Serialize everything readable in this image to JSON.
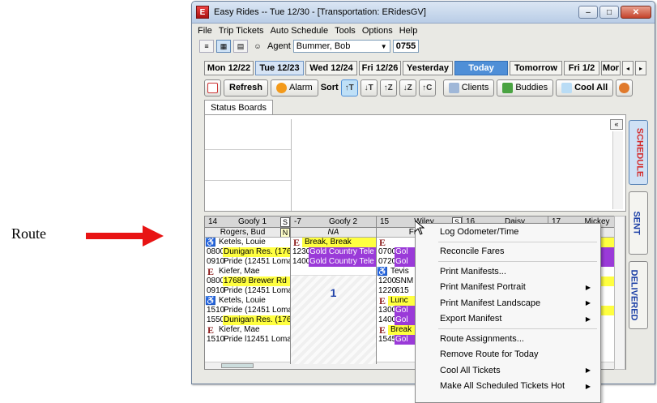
{
  "annotation": {
    "label": "Route"
  },
  "window": {
    "title": "Easy Rides -- Tue 12/30 - [Transportation: ERidesGV]",
    "controls": {
      "minimize": "–",
      "maximize": "□",
      "close": "✕"
    }
  },
  "menu": [
    "File",
    "Trip Tickets",
    "Auto Schedule",
    "Tools",
    "Options",
    "Help"
  ],
  "agentbar": {
    "label": "Agent",
    "agent": "Bummer, Bob",
    "number": "0755"
  },
  "date_tabs": [
    {
      "label": "Mon 12/22",
      "w": 61
    },
    {
      "label": "Tue 12/23",
      "w": 60,
      "state": "selected"
    },
    {
      "label": "Wed 12/24",
      "w": 64
    },
    {
      "label": "Fri 12/26",
      "w": 52
    },
    {
      "label": "Yesterday",
      "w": 62
    },
    {
      "label": "Today",
      "w": 66,
      "state": "today"
    },
    {
      "label": "Tomorrow",
      "w": 65
    },
    {
      "label": "Fri 1/2",
      "w": 44
    },
    {
      "label": "Mor",
      "w": 24
    }
  ],
  "actions": {
    "refresh": "Refresh",
    "alarm": "Alarm",
    "sort": "Sort",
    "sort_buttons": [
      "↑T",
      "↓T",
      "↑Z",
      "↓Z",
      "↑C"
    ],
    "clients": "Clients",
    "buddies": "Buddies",
    "cool_all": "Cool All"
  },
  "subtab": "Status Boards",
  "side_tabs": {
    "schedule": "SCHEDULE",
    "sent": "SENT",
    "delivered": "DELIVERED"
  },
  "routes": [
    {
      "number": "14",
      "name": "Goofy 1",
      "flag": "S",
      "driver": "Rogers, Bud",
      "driver_flag": "N",
      "rows": [
        {
          "type": "name",
          "icon": "hc",
          "text": "Ketels, Louie"
        },
        {
          "type": "stop",
          "time": "0800",
          "text": "Dunigan Res. (176",
          "color": "yellow"
        },
        {
          "type": "stop",
          "time": "0910",
          "text": "Pride (12451 Loma"
        },
        {
          "type": "name",
          "icon": "e",
          "text": "Kiefer, Mae"
        },
        {
          "type": "stop",
          "time": "0800",
          "text": "17689 Brewer Rd",
          "color": "yellow"
        },
        {
          "type": "stop",
          "time": "0910",
          "text": "Pride (12451 Loma"
        },
        {
          "type": "name",
          "icon": "hc",
          "text": "Ketels, Louie"
        },
        {
          "type": "stop",
          "time": "1510",
          "text": "Pride (12451 Loma"
        },
        {
          "type": "stop",
          "time": "1550",
          "text": "Dunigan Res. (176",
          "color": "yellow"
        },
        {
          "type": "name",
          "icon": "e",
          "text": "Kiefer, Mae"
        },
        {
          "type": "stop",
          "time": "1510",
          "text": "Pride l12451 Loma"
        }
      ]
    },
    {
      "number": "-7",
      "name": "Goofy 2",
      "flag": "",
      "driver": "NA",
      "driver_flag": "",
      "big_number": "1",
      "rows": [
        {
          "type": "name",
          "icon": "e",
          "text": "Break, Break",
          "color": "yellow"
        },
        {
          "type": "stop",
          "time": "1230",
          "text": "Gold Country Tele",
          "color": "purple"
        },
        {
          "type": "stop",
          "time": "1400",
          "text": "Gold Country Tele",
          "color": "purple"
        }
      ]
    },
    {
      "number": "15",
      "name": "Wiley",
      "flag": "S",
      "driver": "Frank",
      "driver_flag": "",
      "rows": [
        {
          "type": "name",
          "icon": "e",
          "text": ""
        },
        {
          "type": "stop",
          "time": "0700",
          "text": "Gol",
          "color": "purple"
        },
        {
          "type": "stop",
          "time": "0720",
          "text": "Gol",
          "color": "purple"
        },
        {
          "type": "name",
          "icon": "hc",
          "text": "Tevis"
        },
        {
          "type": "stop",
          "time": "1200",
          "text": "SNM"
        },
        {
          "type": "stop",
          "time": "1220",
          "text": "615"
        },
        {
          "type": "name",
          "icon": "e",
          "text": "Lunc",
          "color": "yellow"
        },
        {
          "type": "stop",
          "time": "1300",
          "text": "Gol",
          "color": "purple"
        },
        {
          "type": "stop",
          "time": "1400",
          "text": "Gol",
          "color": "purple"
        },
        {
          "type": "name",
          "icon": "e",
          "text": "Break",
          "color": "yellow"
        },
        {
          "type": "stop",
          "time": "1545",
          "text": "Gol",
          "color": "purple"
        }
      ]
    },
    {
      "number": "16",
      "name": "Daisy",
      "flag": "",
      "driver": "",
      "driver_flag": "",
      "rows": []
    },
    {
      "number": "17",
      "name": "Mickey",
      "flag": "",
      "driver": "loyd",
      "driver_flag": "",
      "rows": [
        {
          "type": "name",
          "icon": "",
          "text": "break",
          "color": "yellow"
        },
        {
          "type": "stop",
          "time": "",
          "text": "ount",
          "color": "purple"
        },
        {
          "type": "stop",
          "time": "",
          "text": "ount",
          "color": "purple"
        },
        {
          "type": "name",
          "icon": "",
          "text": "m, M"
        },
        {
          "type": "stop",
          "time": "",
          "text": "h Da",
          "color": "yellow"
        },
        {
          "type": "stop",
          "time": "",
          "text": "Jean"
        },
        {
          "type": "name",
          "icon": "",
          "text": "Wall"
        },
        {
          "type": "stop",
          "time": "",
          "text": "h Da",
          "color": "yellow"
        },
        {
          "type": "stop",
          "time": "",
          "text": "Jean"
        },
        {
          "type": "name",
          "icon": "",
          "text": "ean"
        },
        {
          "type": "stop",
          "time": "",
          "text": "enw"
        }
      ]
    }
  ],
  "context_menu": [
    {
      "label": "Log Odometer/Time"
    },
    {
      "sep": true
    },
    {
      "label": "Reconcile Fares"
    },
    {
      "sep": true
    },
    {
      "label": "Print Manifests..."
    },
    {
      "label": "Print Manifest Portrait",
      "submenu": true
    },
    {
      "label": "Print  Manifest Landscape",
      "submenu": true
    },
    {
      "label": "Export Manifest",
      "submenu": true
    },
    {
      "sep": true
    },
    {
      "label": "Route Assignments..."
    },
    {
      "label": "Remove Route for Today"
    },
    {
      "label": "Cool All Tickets",
      "submenu": true
    },
    {
      "label": "Make All Scheduled Tickets Hot",
      "submenu": true
    }
  ],
  "colors": {
    "arrow": "#e81414",
    "today": "#4f8fd7",
    "yellow": "#ffff40",
    "purple": "#9a3ad8"
  }
}
